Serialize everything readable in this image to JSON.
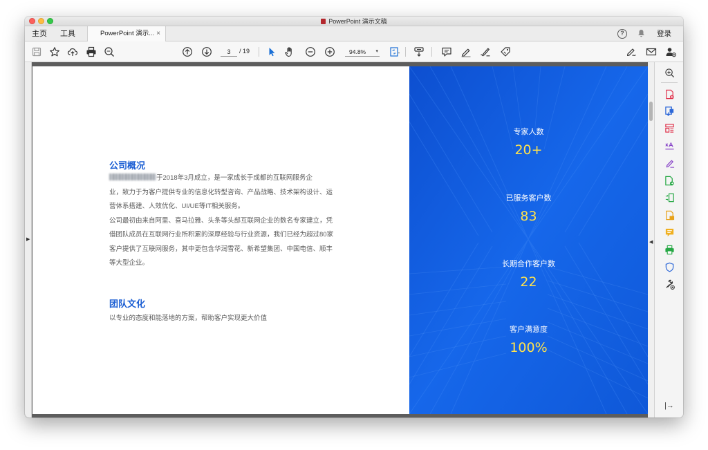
{
  "window": {
    "title": "PowerPoint 演示文稿"
  },
  "tabs": {
    "home": "主页",
    "tools": "工具",
    "document": "PowerPoint 演示...",
    "close": "×"
  },
  "account": {
    "login": "登录"
  },
  "toolbar": {
    "page_current": "3",
    "page_total": "/ 19",
    "zoom": "94.8%"
  },
  "document": {
    "overview": {
      "title": "公司概况",
      "lines": [
        "于2018年3月成立，是一家成长于成都的互联网服务企",
        "业，致力于为客户提供专业的信息化转型咨询、产品战略、技术架构设计、运",
        "营体系搭建、人效优化、UI/UE等IT相关服务。",
        "公司最初由来自阿里、喜马拉雅、头条等头部互联网企业的数名专家建立，凭",
        "借团队成员在互联网行业所积累的深厚经验与行业资源，我们已经为超过80家",
        "客户提供了互联网服务，其中更包含华润雪花、新希望集团、中国电信、顺丰",
        "等大型企业。"
      ]
    },
    "culture": {
      "title": "团队文化",
      "text": "以专业的态度和能落地的方案，帮助客户实现更大价值"
    },
    "stats": [
      {
        "label": "专家人数",
        "value": "20+"
      },
      {
        "label": "已服务客户数",
        "value": "83"
      },
      {
        "label": "长期合作客户数",
        "value": "22"
      },
      {
        "label": "客户满意度",
        "value": "100%"
      }
    ]
  },
  "colors": {
    "accent_blue": "#1b5ed3",
    "panel_blue": "#1565e8",
    "stat_yellow": "#ffe24d"
  }
}
